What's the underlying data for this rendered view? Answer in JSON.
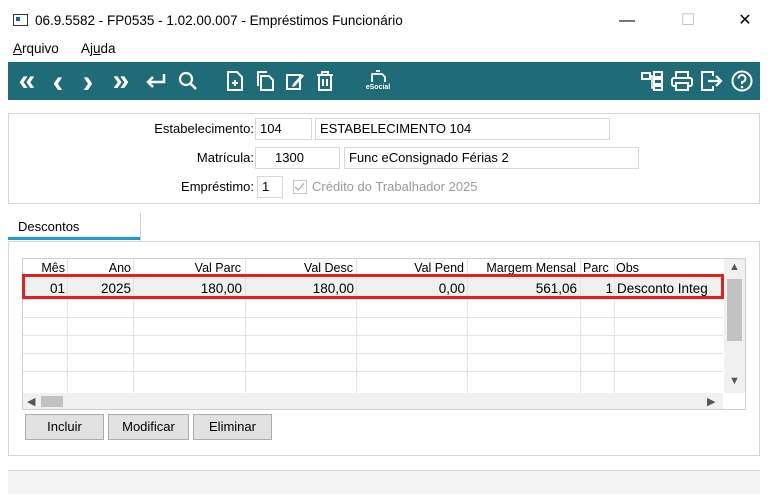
{
  "window": {
    "title": "06.9.5582 - FP0535 - 1.02.00.007 - Empréstimos Funcionário",
    "minimize": "—",
    "maximize": "☐",
    "close": "✕"
  },
  "menu": {
    "items": [
      {
        "pre": "",
        "ul": "A",
        "post": "rquivo"
      },
      {
        "pre": "Aj",
        "ul": "u",
        "post": "da"
      }
    ]
  },
  "toolbar": {
    "first": "«",
    "prev": "‹",
    "next": "›",
    "last": "»",
    "esocial_label": "eSocial"
  },
  "form": {
    "estabelecimento_label": "Estabelecimento:",
    "estabelecimento_code": "104",
    "estabelecimento_name": "ESTABELECIMENTO 104",
    "matricula_label": "Matrícula:",
    "matricula_code": "1300",
    "matricula_name": "Func eConsignado Férias 2",
    "emprestimo_label": "Empréstimo:",
    "emprestimo_code": "1",
    "credito_label": "Crédito do Trabalhador 2025"
  },
  "tabs": [
    {
      "label": "Descontos"
    }
  ],
  "table": {
    "headers": [
      "Mês",
      "Ano",
      "Val Parc",
      "Val Desc",
      "Val Pend",
      "Margem Mensal",
      "Parc",
      "Obs"
    ],
    "rows": [
      [
        "01",
        "2025",
        "180,00",
        "180,00",
        "0,00",
        "561,06",
        "1",
        "Desconto Integ"
      ]
    ]
  },
  "buttons": {
    "incluir": "Incluir",
    "modificar": "Modificar",
    "eliminar": "Eliminar"
  },
  "colors": {
    "toolbar": "#1f6c78",
    "tab_accent": "#1e9bd7",
    "highlight": "#e0201f"
  }
}
